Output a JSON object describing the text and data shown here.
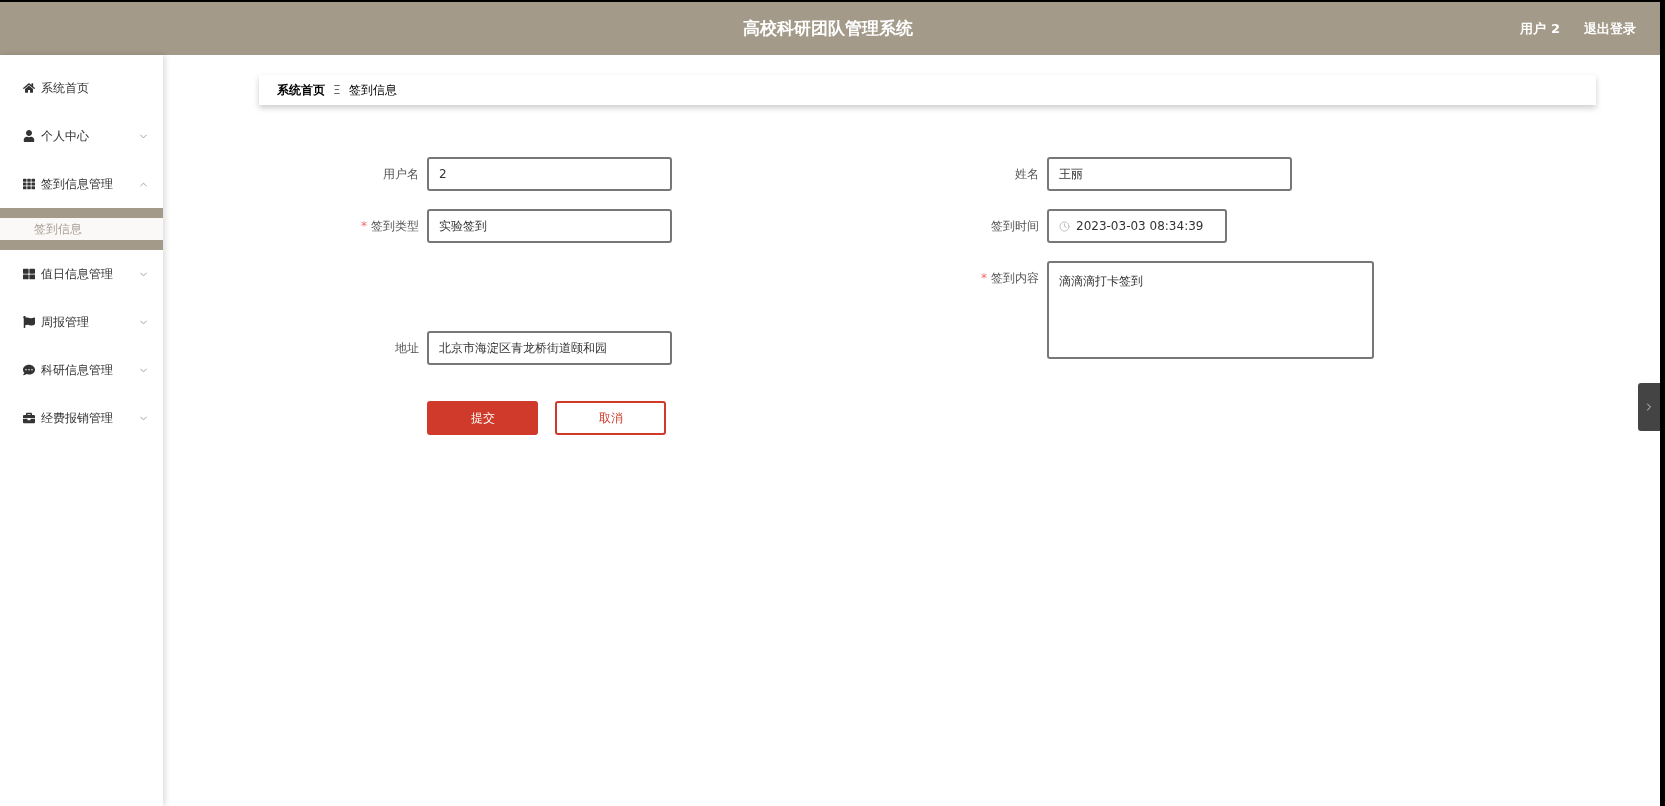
{
  "header": {
    "title": "高校科研团队管理系统",
    "user": "用户 2",
    "logout": "退出登录"
  },
  "sidebar": {
    "items": [
      {
        "kind": "home",
        "label": "系统首页"
      },
      {
        "kind": "user",
        "label": "个人中心",
        "expanded": false
      },
      {
        "kind": "grid",
        "label": "签到信息管理",
        "expanded": true,
        "children": [
          {
            "label": "签到信息",
            "selected": true
          }
        ]
      },
      {
        "kind": "tiles",
        "label": "值日信息管理",
        "expanded": false
      },
      {
        "kind": "flag",
        "label": "周报管理",
        "expanded": false
      },
      {
        "kind": "chat",
        "label": "科研信息管理",
        "expanded": false
      },
      {
        "kind": "case",
        "label": "经费报销管理",
        "expanded": false
      }
    ]
  },
  "breadcrumb": {
    "home": "系统首页",
    "separator": "Ξ",
    "current": "签到信息"
  },
  "form": {
    "left": [
      {
        "label": "用户名",
        "value": "2"
      },
      {
        "label": "签到类型",
        "required_mark": "*",
        "value": "实验签到"
      },
      {
        "label": "地址",
        "value": "北京市海淀区青龙桥街道颐和园"
      }
    ],
    "right": [
      {
        "label": "姓名",
        "value": "王丽"
      },
      {
        "label": "签到时间",
        "kind": "datetime",
        "value": "2023-03-03 08:34:39"
      },
      {
        "label": "签到内容",
        "required_mark": "*",
        "kind": "textarea",
        "value": "滴滴滴打卡签到"
      }
    ],
    "buttons": [
      {
        "label": "提交",
        "kind": "primary"
      },
      {
        "label": "取消",
        "kind": "secondary"
      }
    ]
  }
}
